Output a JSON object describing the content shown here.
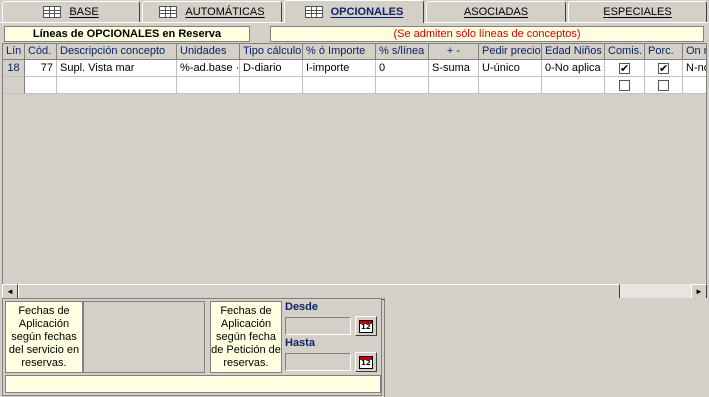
{
  "tabs": [
    {
      "label": "BASE",
      "icon": "table-icon",
      "active": false
    },
    {
      "label": "AUTOMÁTICAS",
      "icon": "table-icon",
      "active": false
    },
    {
      "label": "OPCIONALES",
      "icon": "table-icon",
      "active": true
    },
    {
      "label": "ASOCIADAS",
      "active": false
    },
    {
      "label": "ESPECIALES",
      "active": false
    }
  ],
  "panel": {
    "title": "Líneas de OPCIONALES en Reserva",
    "note": "(Se admiten sólo líneas de conceptos)"
  },
  "grid": {
    "columns": [
      "Lín",
      "Cód.",
      "Descripción concepto",
      "Unidades",
      "Tipo cálculo",
      "% ó Importe",
      "% s/línea",
      "+   -",
      "Pedir precio",
      "Edad Niños",
      "Comis.",
      "Porc.",
      "On r"
    ],
    "rows": [
      {
        "lin": "18",
        "cod": "77",
        "descripcion": "Supl. Vista mar",
        "unidades": "%-ad.base ·",
        "tipo": "D-diario",
        "importe": "I-importe",
        "slinea": "0",
        "signo": "S-suma",
        "pedir": "U-único",
        "edad": "0-No aplica",
        "comis": true,
        "porc": true,
        "onr": "N-no"
      },
      {
        "lin": "",
        "cod": "",
        "descripcion": "",
        "unidades": "",
        "tipo": "",
        "importe": "",
        "slinea": "",
        "signo": "",
        "pedir": "",
        "edad": "",
        "comis": false,
        "porc": false,
        "onr": ""
      }
    ]
  },
  "scrollbar": {
    "left_arrow": "◄",
    "right_arrow": "►"
  },
  "bottom": {
    "note_service": "Fechas de Aplicación según fechas del servicio en reservas.",
    "note_request": "Fechas de Aplicación según fecha de Petición de reservas.",
    "desde_label": "Desde",
    "hasta_label": "Hasta",
    "desde_value": "",
    "hasta_value": ""
  },
  "colors": {
    "accent": "#0a246a",
    "note_bg": "#ffffe1",
    "warning": "#d00000",
    "face": "#d4d0c8"
  }
}
